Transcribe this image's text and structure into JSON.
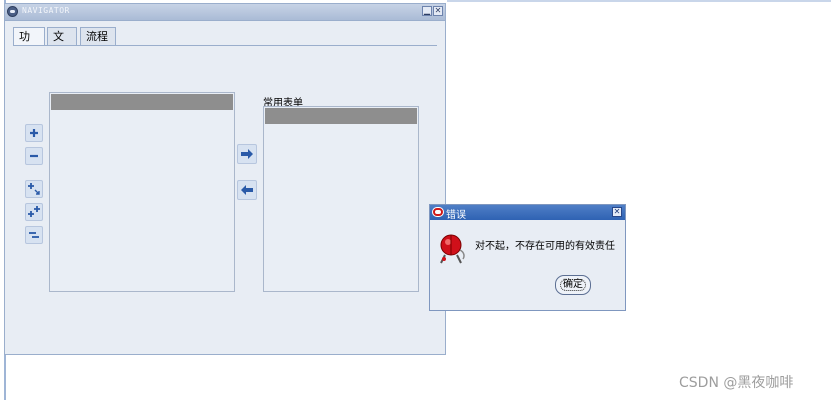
{
  "navigator": {
    "title": "NAVIGATOR",
    "minimize_symbol": "▁",
    "close_symbol": "✕",
    "tabs": [
      {
        "label": "功能",
        "active": true
      },
      {
        "label": "文档",
        "active": false
      },
      {
        "label": "流程",
        "active": false
      }
    ],
    "favorites_label": "常用表单",
    "tree_buttons": [
      "expand-icon",
      "collapse-icon",
      "expand-branch-icon",
      "expand-all-icon",
      "collapse-all-icon"
    ],
    "transfer_buttons": [
      "arrow-right-icon",
      "arrow-left-icon"
    ]
  },
  "dialog": {
    "title": "错误",
    "close_symbol": "✕",
    "message": "对不起，不存在可用的有效责任",
    "ok_label": "确定",
    "icon": "alarm-bell-icon"
  },
  "watermark": "CSDN @黑夜咖啡",
  "colors": {
    "window_bg": "#e8edf4",
    "dialog_titlebar": "#2f62b3",
    "selection_gray": "#8e8e8e",
    "alarm_red": "#d0101a"
  }
}
